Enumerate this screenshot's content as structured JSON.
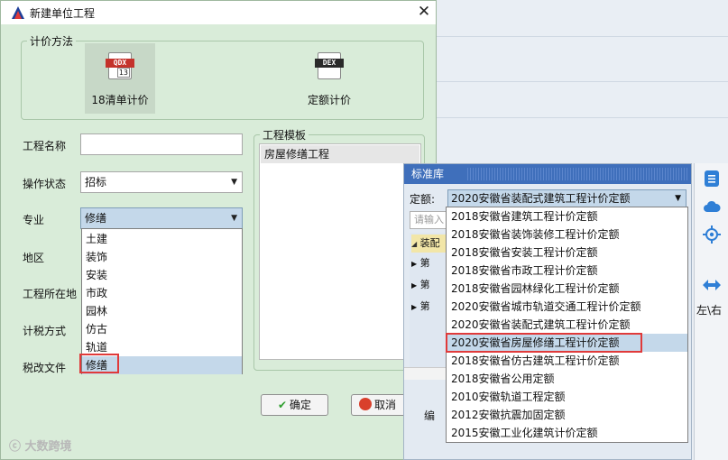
{
  "dialog": {
    "title": "新建单位工程",
    "pricing_group": {
      "legend": "计价方法",
      "methods": [
        {
          "label": "18清单计价",
          "icon_text": "QDX",
          "icon_num": "13",
          "selected": true
        },
        {
          "label": "定额计价",
          "icon_text": "DEX",
          "selected": false
        }
      ]
    },
    "fields": {
      "project_name": {
        "label": "工程名称",
        "value": ""
      },
      "operation_status": {
        "label": "操作状态",
        "value": "招标"
      },
      "specialty": {
        "label": "专业",
        "value": "修缮"
      },
      "region": {
        "label": "地区"
      },
      "location": {
        "label": "工程所在地"
      },
      "tax_method": {
        "label": "计税方式"
      },
      "tax_file": {
        "label": "税改文件"
      }
    },
    "specialty_options": [
      "土建",
      "装饰",
      "安装",
      "市政",
      "园林",
      "仿古",
      "轨道",
      "修缮"
    ],
    "selected_specialty_index": 7,
    "template_group": {
      "legend": "工程模板",
      "items": [
        "房屋修缮工程"
      ]
    },
    "buttons": {
      "ok": "确定",
      "cancel": "取消"
    }
  },
  "library": {
    "title": "标准库",
    "quota_label": "定额:",
    "quota_value": "2020安徽省装配式建筑工程计价定额",
    "search_placeholder": "请输入",
    "tree_items": [
      "装配",
      "第",
      "第",
      "第"
    ],
    "bottom_tab": "编",
    "quota_options": [
      "2018安徽省建筑工程计价定额",
      "2018安徽省装饰装修工程计价定额",
      "2018安徽省安装工程计价定额",
      "2018安徽省市政工程计价定额",
      "2018安徽省园林绿化工程计价定额",
      "2020安徽省城市轨道交通工程计价定额",
      "2020安徽省装配式建筑工程计价定额",
      "2020安徽省房屋修缮工程计价定额",
      "2018安徽省仿古建筑工程计价定额",
      "2018安徽省公用定额",
      "2010安徽轨道工程定额",
      "2012安徽抗震加固定额",
      "2015安徽工业化建筑计价定额"
    ],
    "selected_quota_index": 7
  },
  "right_toolbar": {
    "label": "左\\右"
  },
  "watermark": "大数跨境",
  "colors": {
    "accent_blue": "#3f6fbb",
    "highlight_red": "#e03a3a",
    "dialog_green": "#d9ecd9",
    "selection": "#c4d8ea"
  }
}
